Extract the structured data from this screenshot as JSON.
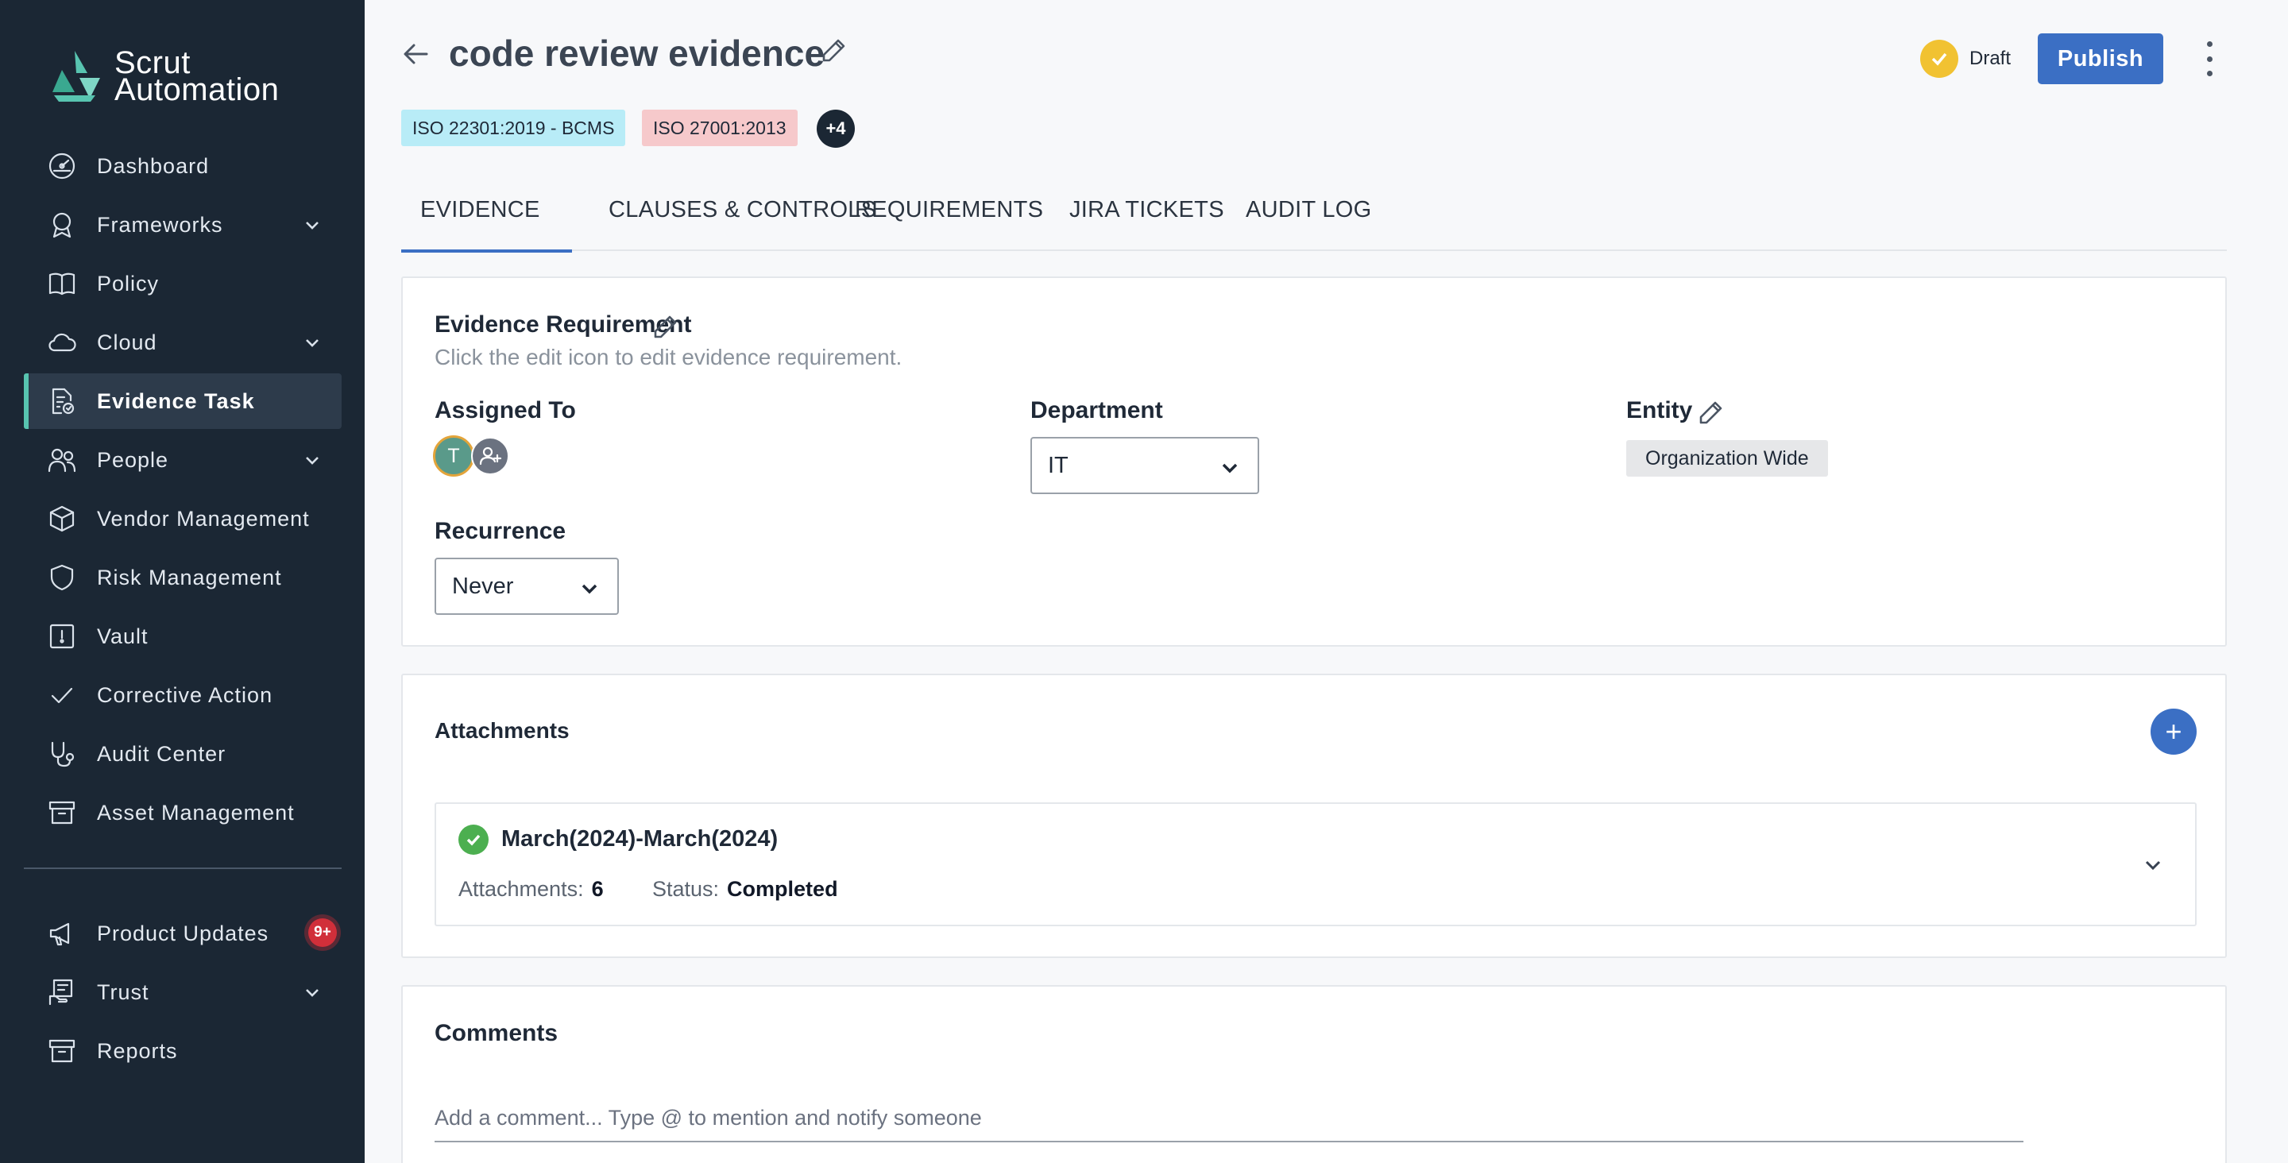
{
  "brand": {
    "line1": "Scrut",
    "line2": "Automation",
    "accent": "#58c4b0"
  },
  "sidebar": {
    "items": [
      {
        "label": "Dashboard",
        "icon": "dashboard-icon",
        "expandable": false
      },
      {
        "label": "Frameworks",
        "icon": "award-icon",
        "expandable": true
      },
      {
        "label": "Policy",
        "icon": "book-icon",
        "expandable": false
      },
      {
        "label": "Cloud",
        "icon": "cloud-icon",
        "expandable": true
      },
      {
        "label": "Evidence Task",
        "icon": "evidence-icon",
        "expandable": false,
        "active": true
      },
      {
        "label": "People",
        "icon": "people-icon",
        "expandable": true
      },
      {
        "label": "Vendor Management",
        "icon": "box-icon",
        "expandable": false
      },
      {
        "label": "Risk Management",
        "icon": "shield-icon",
        "expandable": false
      },
      {
        "label": "Vault",
        "icon": "vault-icon",
        "expandable": false
      },
      {
        "label": "Corrective Action",
        "icon": "check-icon",
        "expandable": false
      },
      {
        "label": "Audit Center",
        "icon": "stethoscope-icon",
        "expandable": false
      },
      {
        "label": "Asset Management",
        "icon": "archive-icon",
        "expandable": false
      }
    ],
    "bottom_items": [
      {
        "label": "Product Updates",
        "icon": "megaphone-icon",
        "badge": "9+"
      },
      {
        "label": "Trust",
        "icon": "trust-icon",
        "expandable": true
      },
      {
        "label": "Reports",
        "icon": "reports-icon"
      }
    ]
  },
  "header": {
    "title": "code review evidence",
    "tags": [
      "ISO 22301:2019 - BCMS",
      "ISO 27001:2013"
    ],
    "more_tags": "+4",
    "status_label": "Draft",
    "publish_label": "Publish"
  },
  "tabs": [
    "EVIDENCE",
    "CLAUSES & CONTROLS",
    "REQUIREMENTS",
    "JIRA TICKETS",
    "AUDIT LOG"
  ],
  "requirement": {
    "title": "Evidence Requirement",
    "subtitle": "Click the edit icon to edit evidence requirement.",
    "assigned_label": "Assigned To",
    "assignee_initial": "T",
    "department_label": "Department",
    "department_value": "IT",
    "entity_label": "Entity",
    "entity_value": "Organization Wide",
    "recurrence_label": "Recurrence",
    "recurrence_value": "Never"
  },
  "attachments": {
    "title": "Attachments",
    "add_label": "+",
    "rows": [
      {
        "name": "March(2024)-March(2024)",
        "attachments_label": "Attachments:",
        "attachments_count": "6",
        "status_label": "Status:",
        "status_value": "Completed"
      }
    ]
  },
  "comments": {
    "title": "Comments",
    "placeholder": "Add a comment... Type @ to mention and notify someone"
  },
  "colors": {
    "sidebar_bg": "#1b2734",
    "primary": "#3b6fc4",
    "draft": "#f1c232",
    "success": "#4caf50"
  }
}
